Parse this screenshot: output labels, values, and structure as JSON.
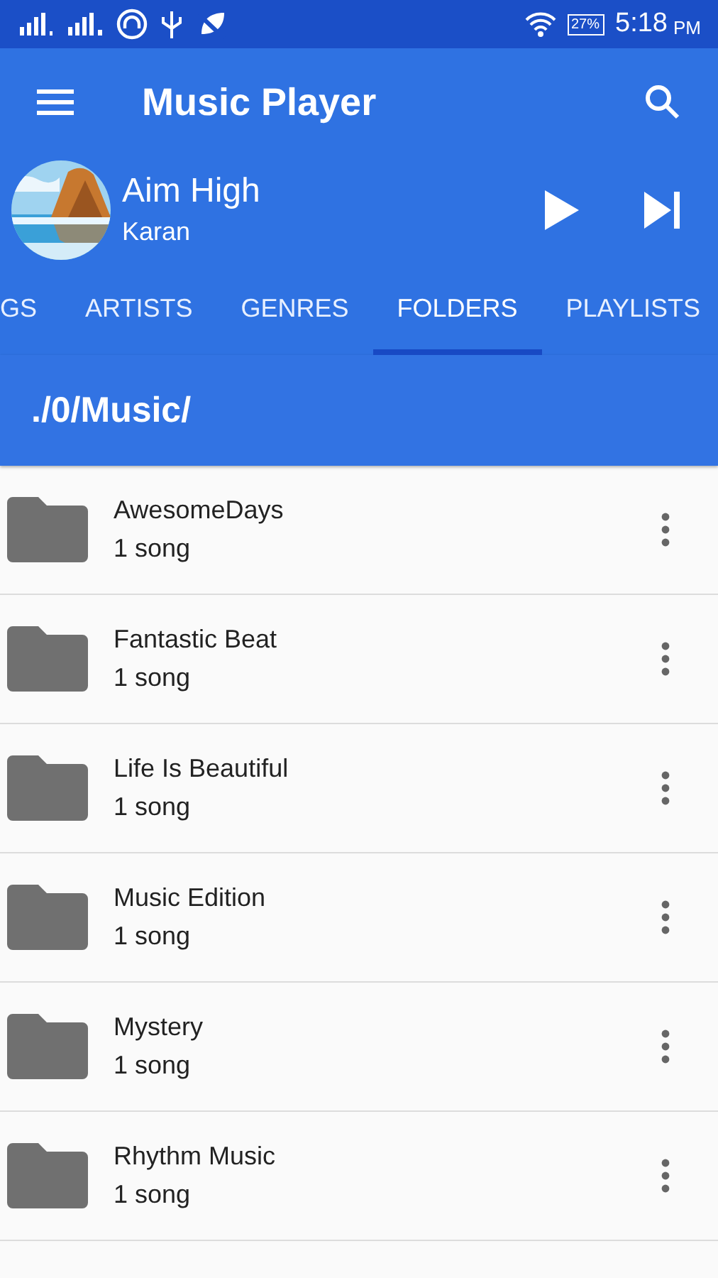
{
  "status_bar": {
    "battery": "27%",
    "time": "5:18",
    "meridiem": "PM"
  },
  "toolbar": {
    "title": "Music Player"
  },
  "now_playing": {
    "title": "Aim High",
    "artist": "Karan"
  },
  "tabs": [
    {
      "label": "GS",
      "selected": false
    },
    {
      "label": "ARTISTS",
      "selected": false
    },
    {
      "label": "GENRES",
      "selected": false
    },
    {
      "label": "FOLDERS",
      "selected": true
    },
    {
      "label": "PLAYLISTS",
      "selected": false
    }
  ],
  "path": "./0/Music/",
  "folders": [
    {
      "name": "AwesomeDays",
      "count": "1 song"
    },
    {
      "name": "Fantastic Beat",
      "count": "1 song"
    },
    {
      "name": "Life Is Beautiful",
      "count": "1 song"
    },
    {
      "name": "Music Edition",
      "count": "1 song"
    },
    {
      "name": "Mystery",
      "count": "1 song"
    },
    {
      "name": "Rhythm Music",
      "count": "1 song"
    }
  ]
}
